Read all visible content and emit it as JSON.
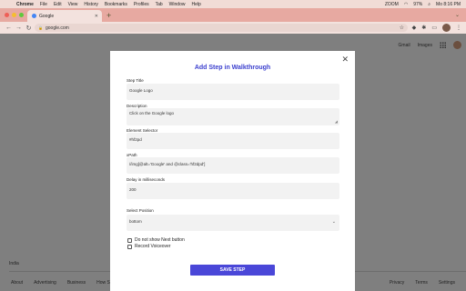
{
  "menubar": {
    "apple": "",
    "items": [
      "Chrome",
      "File",
      "Edit",
      "View",
      "History",
      "Bookmarks",
      "Profiles",
      "Tab",
      "Window",
      "Help"
    ],
    "zoom": "ZOOM",
    "battery": "97%",
    "datetime": "Mo 8:16 PM"
  },
  "browser": {
    "tab_title": "Google",
    "url": "google.com"
  },
  "google": {
    "gmail": "Gmail",
    "images": "Images",
    "country": "India",
    "footer_left": [
      "About",
      "Advertising",
      "Business",
      "How Se"
    ],
    "footer_right": [
      "Privacy",
      "Terms",
      "Settings"
    ]
  },
  "modal": {
    "title": "Add Step in Walkthrough",
    "close": "✕",
    "step_title_label": "Step Title",
    "step_title_value": "Google Logo",
    "description_label": "Description",
    "description_value": "Click on the Google logo",
    "selector_label": "Element Selector",
    "selector_value": "#hf2pd",
    "xpath_label": "xPath",
    "xpath_value": "//img[@alt='Google' and @class='hf2dpd']",
    "delay_label": "Delay in milliseconds",
    "delay_value": "200",
    "position_label": "Select Position",
    "position_value": "bottom",
    "checkbox_next": "Do not show Next button",
    "checkbox_voice": "Record Voiceover",
    "save_button": "SAVE STEP"
  },
  "colors": {
    "accent": "#4a47d8",
    "title": "#3b3fce",
    "menubar": "#f1dcd6",
    "tabstrip": "#e7a9a1"
  }
}
